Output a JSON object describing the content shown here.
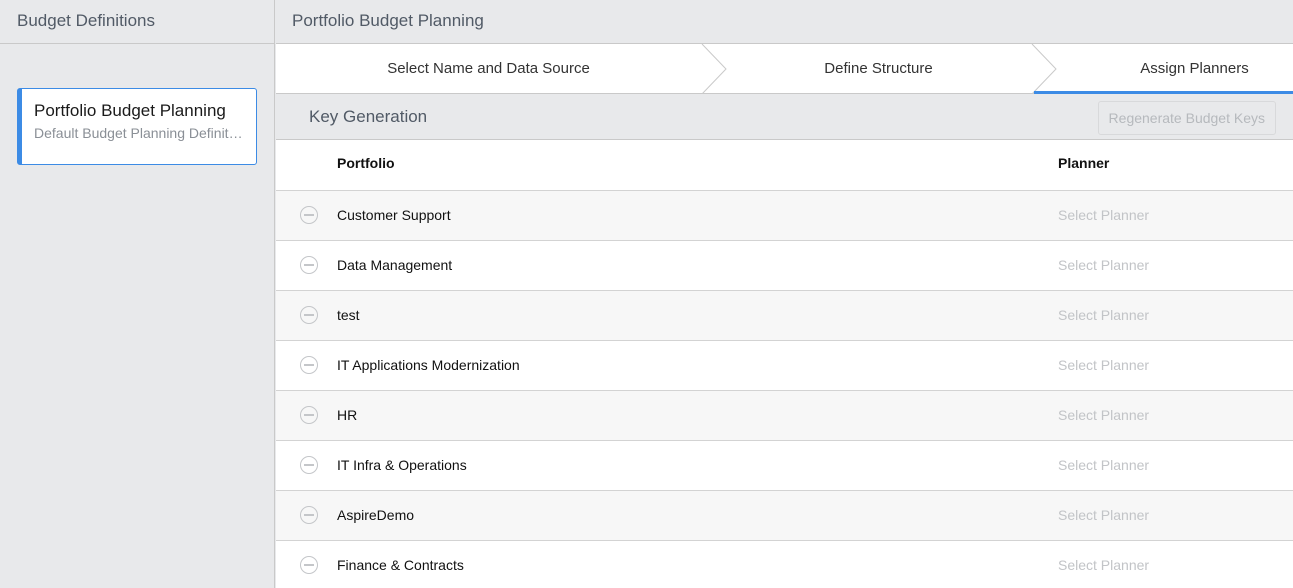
{
  "sidebar": {
    "title": "Budget Definitions",
    "definitions": [
      {
        "title": "Portfolio Budget Planning",
        "subtitle": "Default Budget Planning Definition"
      }
    ]
  },
  "main": {
    "title": "Portfolio Budget Planning",
    "steps": [
      {
        "label": "Select Name and Data Source",
        "active": false
      },
      {
        "label": "Define Structure",
        "active": false
      },
      {
        "label": "Assign Planners",
        "active": true
      }
    ],
    "section_title": "Key Generation",
    "regenerate_button": "Regenerate Budget Keys",
    "table": {
      "columns": [
        "Portfolio",
        "Planner"
      ],
      "rows": [
        {
          "portfolio": "Customer Support",
          "planner_placeholder": "Select Planner"
        },
        {
          "portfolio": "Data Management",
          "planner_placeholder": "Select Planner"
        },
        {
          "portfolio": "test",
          "planner_placeholder": "Select Planner"
        },
        {
          "portfolio": "IT Applications Modernization",
          "planner_placeholder": "Select Planner"
        },
        {
          "portfolio": "HR",
          "planner_placeholder": "Select Planner"
        },
        {
          "portfolio": "IT Infra & Operations",
          "planner_placeholder": "Select Planner"
        },
        {
          "portfolio": "AspireDemo",
          "planner_placeholder": "Select Planner"
        },
        {
          "portfolio": "Finance & Contracts",
          "planner_placeholder": "Select Planner"
        }
      ]
    }
  },
  "colors": {
    "accent": "#3c8be5",
    "header_bg": "#e8e9eb",
    "placeholder_text": "#c2c4c7"
  },
  "icons": {
    "row_remove": "minus-circle-icon",
    "step_separator": "chevron-right-icon"
  }
}
